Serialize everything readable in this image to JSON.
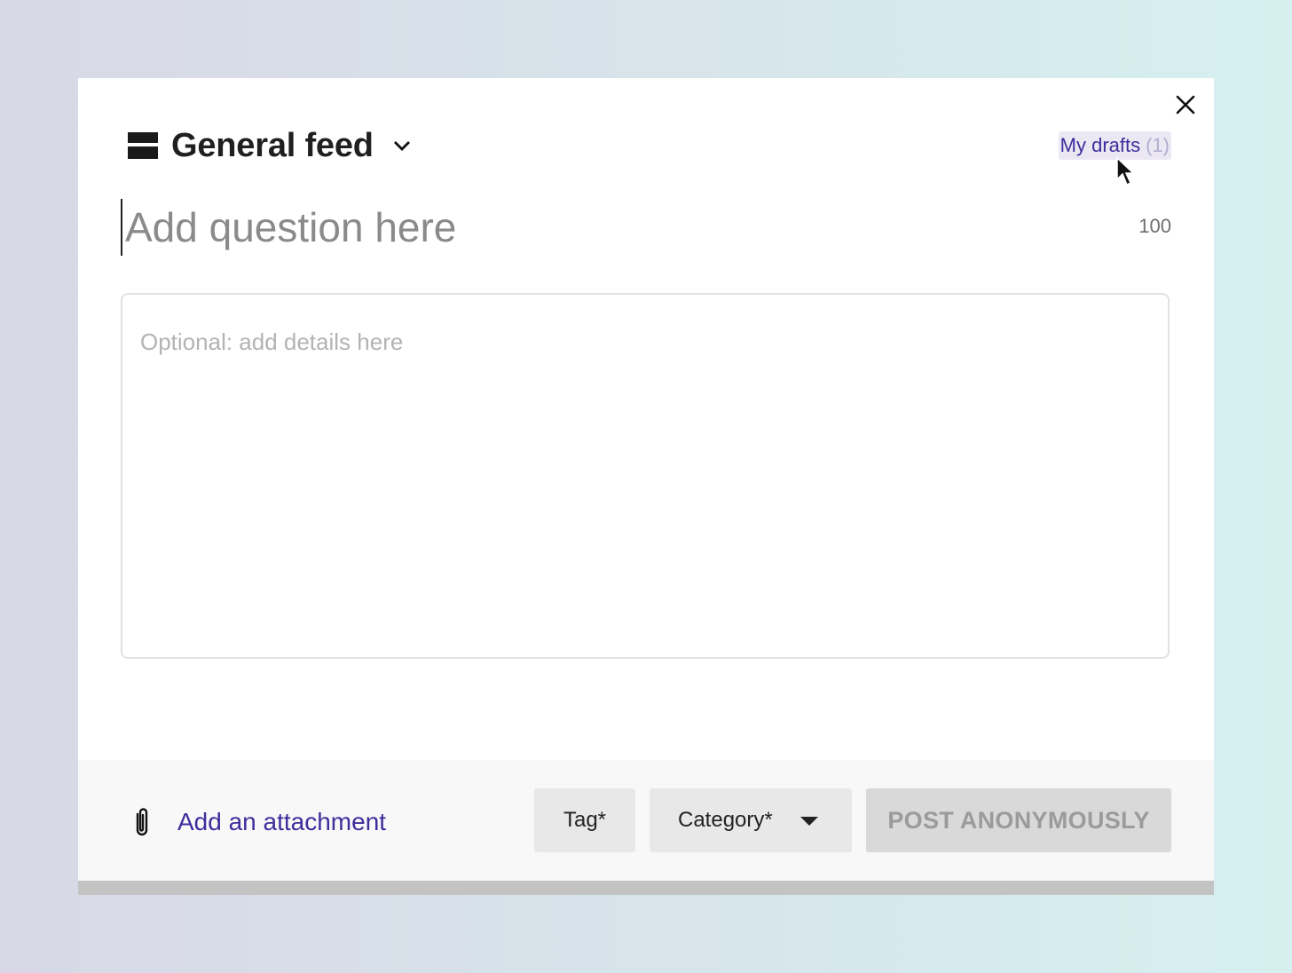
{
  "dialog": {
    "feed": {
      "title": "General feed",
      "icon": "feed-icon",
      "dropdown_icon": "chevron-down-icon"
    },
    "close_icon": "close-icon",
    "drafts": {
      "label": "My drafts",
      "count": "(1)"
    },
    "question": {
      "placeholder": "Add question here",
      "value": "",
      "char_limit": "100"
    },
    "details": {
      "placeholder": "Optional: add details here",
      "value": ""
    },
    "footer": {
      "attachment_icon": "paperclip-icon",
      "attachment_label": "Add an attachment",
      "tag_label": "Tag*",
      "category_label": "Category*",
      "category_icon": "caret-down-icon",
      "post_label": "POST ANONYMOUSLY"
    }
  },
  "colors": {
    "accent": "#3d2e9c",
    "drafts_bg": "#ebe8f4",
    "footer_bg": "#f8f8f8",
    "button_bg": "#e8e8e8",
    "disabled_button_bg": "#d9d9d9"
  }
}
